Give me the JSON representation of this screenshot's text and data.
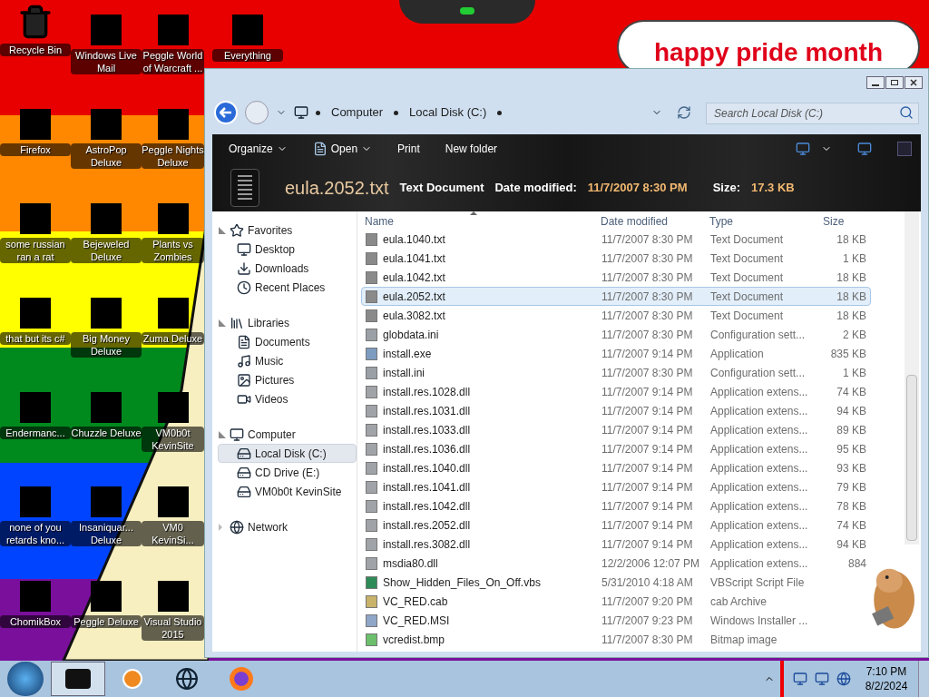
{
  "desktop_icons": [
    [
      {
        "label": "Recycle Bin",
        "kind": "bin"
      },
      {
        "label": "Windows Live Mail",
        "kind": "app"
      },
      {
        "label": "Peggle World of Warcraft ...",
        "kind": "app"
      },
      {
        "label": "Everything",
        "kind": "app"
      }
    ],
    [
      {
        "label": "Firefox",
        "kind": "app"
      },
      {
        "label": "AstroPop Deluxe",
        "kind": "app"
      },
      {
        "label": "Peggle Nights Deluxe",
        "kind": "app"
      }
    ],
    [
      {
        "label": "some russian ran a rat",
        "kind": "app"
      },
      {
        "label": "Bejeweled Deluxe",
        "kind": "app"
      },
      {
        "label": "Plants vs Zombies",
        "kind": "app"
      }
    ],
    [
      {
        "label": "that but its c#",
        "kind": "app"
      },
      {
        "label": "Big Money Deluxe",
        "kind": "app"
      },
      {
        "label": "Zuma Deluxe",
        "kind": "app"
      }
    ],
    [
      {
        "label": "Endermanc...",
        "kind": "app"
      },
      {
        "label": "Chuzzle Deluxe",
        "kind": "app"
      },
      {
        "label": "VM0b0t KevinSite",
        "kind": "app"
      }
    ],
    [
      {
        "label": "none of you retards kno...",
        "kind": "app"
      },
      {
        "label": "Insaniquar... Deluxe",
        "kind": "app"
      },
      {
        "label": "VM0 KevinSi...",
        "kind": "app"
      }
    ],
    [
      {
        "label": "ChomikBox",
        "kind": "app"
      },
      {
        "label": "Peggle Deluxe",
        "kind": "app"
      },
      {
        "label": "Visual Studio 2015",
        "kind": "app"
      }
    ]
  ],
  "sticker": {
    "text": "happy pride month"
  },
  "explorer": {
    "breadcrumb": [
      "Computer",
      "Local Disk (C:)"
    ],
    "search": {
      "placeholder": "Search Local Disk (C:)"
    },
    "toolbar": [
      {
        "label": "Organize",
        "dropdown": true,
        "icon": false
      },
      {
        "label": "Open",
        "dropdown": true,
        "icon": true
      },
      {
        "label": "Print",
        "dropdown": false,
        "icon": false
      },
      {
        "label": "New folder",
        "dropdown": false,
        "icon": false
      }
    ],
    "details": {
      "name": "eula.2052.txt",
      "type": "Text Document",
      "date_label": "Date modified:",
      "date_value": "11/7/2007 8:30 PM",
      "size_label": "Size:",
      "size_value": "17.3 KB"
    },
    "nav": [
      {
        "label": "Favorites",
        "kind": "star",
        "expanded": true,
        "selected": false,
        "children": [
          {
            "label": "Desktop",
            "kind": "desktop",
            "selected": false
          },
          {
            "label": "Downloads",
            "kind": "download",
            "selected": false
          },
          {
            "label": "Recent Places",
            "kind": "recent",
            "selected": false
          }
        ]
      },
      {
        "label": "Libraries",
        "kind": "library",
        "expanded": true,
        "selected": false,
        "children": [
          {
            "label": "Documents",
            "kind": "doc",
            "selected": false
          },
          {
            "label": "Music",
            "kind": "music",
            "selected": false
          },
          {
            "label": "Pictures",
            "kind": "picture",
            "selected": false
          },
          {
            "label": "Videos",
            "kind": "video",
            "selected": false
          }
        ]
      },
      {
        "label": "Computer",
        "kind": "computer",
        "expanded": true,
        "selected": false,
        "children": [
          {
            "label": "Local Disk (C:)",
            "kind": "drive",
            "selected": true
          },
          {
            "label": "CD Drive (E:)",
            "kind": "drive",
            "selected": false
          },
          {
            "label": "VM0b0t KevinSite",
            "kind": "drive",
            "selected": false
          }
        ]
      },
      {
        "label": "Network",
        "kind": "network",
        "expanded": false,
        "selected": false
      }
    ],
    "columns": [
      {
        "label": "Name",
        "sorted": true
      },
      {
        "label": "Date modified",
        "sorted": false
      },
      {
        "label": "Type",
        "sorted": false
      },
      {
        "label": "Size",
        "sorted": false
      }
    ],
    "files": [
      {
        "name": "eula.1040.txt",
        "date": "11/7/2007 8:30 PM",
        "type": "Text Document",
        "size": "18 KB",
        "kind": "txt",
        "selected": false
      },
      {
        "name": "eula.1041.txt",
        "date": "11/7/2007 8:30 PM",
        "type": "Text Document",
        "size": "1 KB",
        "kind": "txt",
        "selected": false
      },
      {
        "name": "eula.1042.txt",
        "date": "11/7/2007 8:30 PM",
        "type": "Text Document",
        "size": "18 KB",
        "kind": "txt",
        "selected": false
      },
      {
        "name": "eula.2052.txt",
        "date": "11/7/2007 8:30 PM",
        "type": "Text Document",
        "size": "18 KB",
        "kind": "txt",
        "selected": true
      },
      {
        "name": "eula.3082.txt",
        "date": "11/7/2007 8:30 PM",
        "type": "Text Document",
        "size": "18 KB",
        "kind": "txt",
        "selected": false
      },
      {
        "name": "globdata.ini",
        "date": "11/7/2007 8:30 PM",
        "type": "Configuration sett...",
        "size": "2 KB",
        "kind": "ini",
        "selected": false
      },
      {
        "name": "install.exe",
        "date": "11/7/2007 9:14 PM",
        "type": "Application",
        "size": "835 KB",
        "kind": "exe",
        "selected": false
      },
      {
        "name": "install.ini",
        "date": "11/7/2007 8:30 PM",
        "type": "Configuration sett...",
        "size": "1 KB",
        "kind": "ini",
        "selected": false
      },
      {
        "name": "install.res.1028.dll",
        "date": "11/7/2007 9:14 PM",
        "type": "Application extens...",
        "size": "74 KB",
        "kind": "dll",
        "selected": false
      },
      {
        "name": "install.res.1031.dll",
        "date": "11/7/2007 9:14 PM",
        "type": "Application extens...",
        "size": "94 KB",
        "kind": "dll",
        "selected": false
      },
      {
        "name": "install.res.1033.dll",
        "date": "11/7/2007 9:14 PM",
        "type": "Application extens...",
        "size": "89 KB",
        "kind": "dll",
        "selected": false
      },
      {
        "name": "install.res.1036.dll",
        "date": "11/7/2007 9:14 PM",
        "type": "Application extens...",
        "size": "95 KB",
        "kind": "dll",
        "selected": false
      },
      {
        "name": "install.res.1040.dll",
        "date": "11/7/2007 9:14 PM",
        "type": "Application extens...",
        "size": "93 KB",
        "kind": "dll",
        "selected": false
      },
      {
        "name": "install.res.1041.dll",
        "date": "11/7/2007 9:14 PM",
        "type": "Application extens...",
        "size": "79 KB",
        "kind": "dll",
        "selected": false
      },
      {
        "name": "install.res.1042.dll",
        "date": "11/7/2007 9:14 PM",
        "type": "Application extens...",
        "size": "78 KB",
        "kind": "dll",
        "selected": false
      },
      {
        "name": "install.res.2052.dll",
        "date": "11/7/2007 9:14 PM",
        "type": "Application extens...",
        "size": "74 KB",
        "kind": "dll",
        "selected": false
      },
      {
        "name": "install.res.3082.dll",
        "date": "11/7/2007 9:14 PM",
        "type": "Application extens...",
        "size": "94 KB",
        "kind": "dll",
        "selected": false
      },
      {
        "name": "msdia80.dll",
        "date": "12/2/2006 12:07 PM",
        "type": "Application extens...",
        "size": "884",
        "kind": "dll",
        "selected": false
      },
      {
        "name": "Show_Hidden_Files_On_Off.vbs",
        "date": "5/31/2010 4:18 AM",
        "type": "VBScript Script File",
        "kind": "vbs",
        "selected": false
      },
      {
        "name": "VC_RED.cab",
        "date": "11/7/2007 9:20 PM",
        "type": "cab Archive",
        "kind": "cab",
        "selected": false
      },
      {
        "name": "VC_RED.MSI",
        "date": "11/7/2007 9:23 PM",
        "type": "Windows Installer ...",
        "kind": "msi",
        "selected": false
      },
      {
        "name": "vcredist.bmp",
        "date": "11/7/2007 8:30 PM",
        "type": "Bitmap image",
        "kind": "bmp",
        "selected": false
      }
    ]
  },
  "taskbar": {
    "apps": [
      {
        "kind": "explorer",
        "selected": true
      },
      {
        "kind": "media",
        "selected": false
      },
      {
        "kind": "globe",
        "selected": false
      },
      {
        "kind": "firefox",
        "selected": false
      }
    ],
    "time": "7:10 PM",
    "date": "8/2/2024"
  }
}
